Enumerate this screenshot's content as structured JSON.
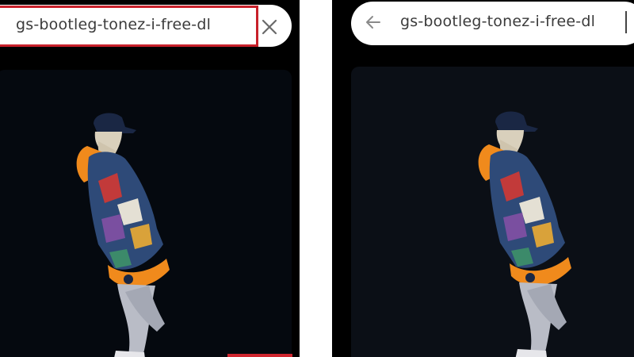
{
  "left_panel": {
    "search": {
      "query": "gs-bootleg-tonez-i-free-dl",
      "clear_icon": "close-icon"
    },
    "thumbnail": {
      "icon": "person-silhouette"
    },
    "colors": {
      "highlight": "#c8202a",
      "background": "#000000"
    }
  },
  "right_panel": {
    "search": {
      "query": "gs-bootleg-tonez-i-free-dl",
      "back_icon": "arrow-left-icon"
    },
    "thumbnail": {
      "icon": "person-silhouette"
    }
  }
}
